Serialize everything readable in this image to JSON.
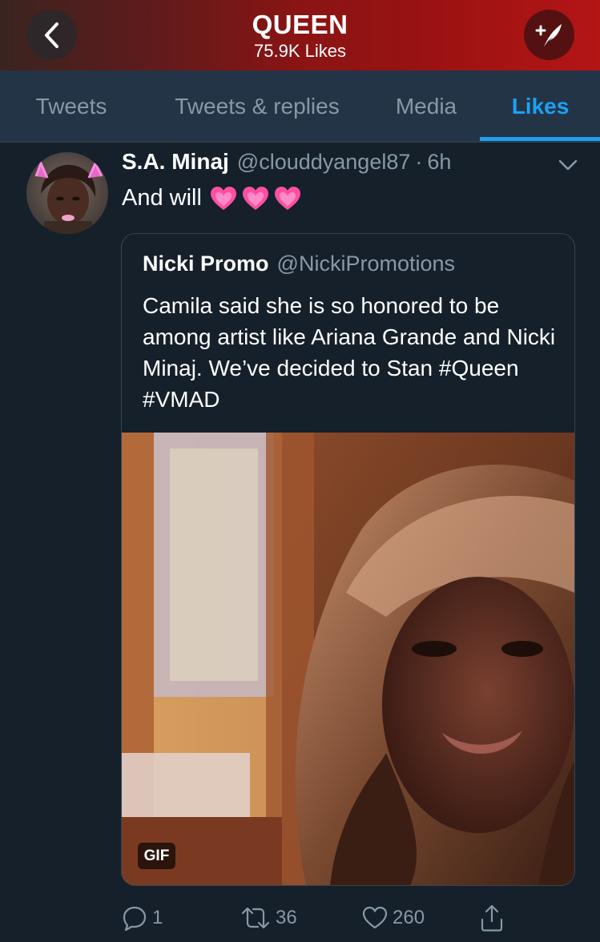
{
  "header": {
    "title": "QUEEN",
    "subtitle": "75.9K Likes",
    "back_icon": "chevron-left-icon",
    "compose_icon": "compose-tweet-icon"
  },
  "tabs": [
    {
      "label": "Tweets",
      "active": false
    },
    {
      "label": "Tweets & replies",
      "active": false
    },
    {
      "label": "Media",
      "active": false
    },
    {
      "label": "Likes",
      "active": true
    }
  ],
  "tweet": {
    "author_name": "S.A. Minaj",
    "author_handle": "@clouddyangel87",
    "separator": "·",
    "timestamp": "6h",
    "text": "And will",
    "emoji_icon": "pink-heart-icon",
    "emoji_count": 3,
    "quoted": {
      "author_name": "Nicki Promo",
      "author_handle": "@NickiPromotions",
      "text": "Camila said she is so honored to be among artist like Ariana Grande and Nicki Minaj. We’ve decided to Stan #Queen #VMAD",
      "media_badge": "GIF"
    },
    "actions": {
      "replies": "1",
      "retweets": "36",
      "likes": "260"
    }
  },
  "colors": {
    "background": "#15202b",
    "tabs_background": "#243447",
    "accent": "#1da1f2",
    "secondary_text": "#8899a6",
    "heart_pink": "#ff4fa3"
  }
}
